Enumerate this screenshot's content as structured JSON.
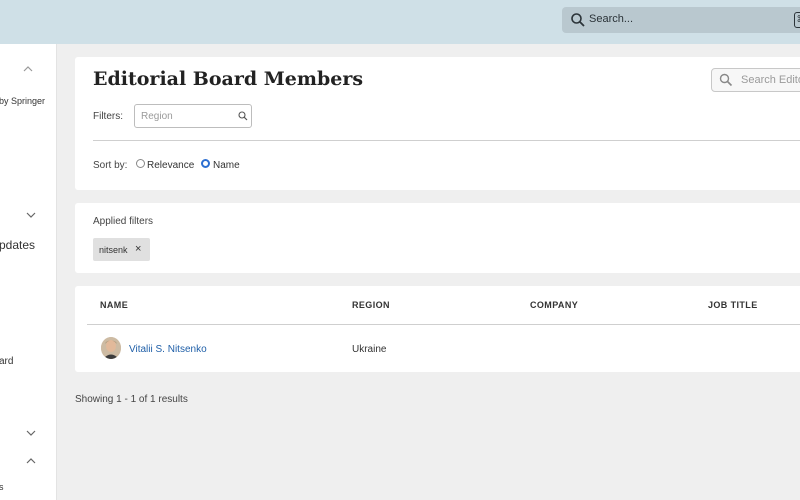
{
  "header": {
    "search_placeholder": "Search...",
    "shortcut_key": "⌘"
  },
  "sidebar": {
    "fragments": [
      "by Springer",
      "pdates",
      "ard",
      "s"
    ]
  },
  "board": {
    "title": "Editorial Board Members",
    "search_placeholder": "Search Editors",
    "filters_label": "Filters:",
    "region_placeholder": "Region",
    "sort_label": "Sort by:",
    "sort_options": [
      {
        "label": "Relevance",
        "selected": false
      },
      {
        "label": "Name",
        "selected": true
      }
    ]
  },
  "applied": {
    "label": "Applied filters",
    "chips": [
      {
        "text": "nitsenk",
        "remove": "×"
      }
    ]
  },
  "table": {
    "columns": [
      "NAME",
      "REGION",
      "COMPANY",
      "JOB TITLE"
    ],
    "rows": [
      {
        "name": "Vitalii S. Nitsenko",
        "region": "Ukraine",
        "company": "",
        "job_title": ""
      }
    ]
  },
  "results_text": "Showing 1 - 1 of 1 results",
  "colors": {
    "topbar": "#cfe0e7",
    "link": "#1f5fa8",
    "radio_selected": "#2d6fd1"
  }
}
